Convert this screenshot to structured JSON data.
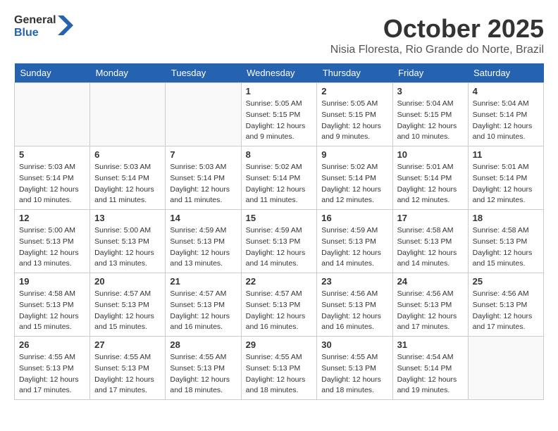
{
  "header": {
    "logo_general": "General",
    "logo_blue": "Blue",
    "month_title": "October 2025",
    "subtitle": "Nisia Floresta, Rio Grande do Norte, Brazil"
  },
  "weekdays": [
    "Sunday",
    "Monday",
    "Tuesday",
    "Wednesday",
    "Thursday",
    "Friday",
    "Saturday"
  ],
  "weeks": [
    [
      {
        "day": "",
        "info": ""
      },
      {
        "day": "",
        "info": ""
      },
      {
        "day": "",
        "info": ""
      },
      {
        "day": "1",
        "info": "Sunrise: 5:05 AM\nSunset: 5:15 PM\nDaylight: 12 hours\nand 9 minutes."
      },
      {
        "day": "2",
        "info": "Sunrise: 5:05 AM\nSunset: 5:15 PM\nDaylight: 12 hours\nand 9 minutes."
      },
      {
        "day": "3",
        "info": "Sunrise: 5:04 AM\nSunset: 5:15 PM\nDaylight: 12 hours\nand 10 minutes."
      },
      {
        "day": "4",
        "info": "Sunrise: 5:04 AM\nSunset: 5:14 PM\nDaylight: 12 hours\nand 10 minutes."
      }
    ],
    [
      {
        "day": "5",
        "info": "Sunrise: 5:03 AM\nSunset: 5:14 PM\nDaylight: 12 hours\nand 10 minutes."
      },
      {
        "day": "6",
        "info": "Sunrise: 5:03 AM\nSunset: 5:14 PM\nDaylight: 12 hours\nand 11 minutes."
      },
      {
        "day": "7",
        "info": "Sunrise: 5:03 AM\nSunset: 5:14 PM\nDaylight: 12 hours\nand 11 minutes."
      },
      {
        "day": "8",
        "info": "Sunrise: 5:02 AM\nSunset: 5:14 PM\nDaylight: 12 hours\nand 11 minutes."
      },
      {
        "day": "9",
        "info": "Sunrise: 5:02 AM\nSunset: 5:14 PM\nDaylight: 12 hours\nand 12 minutes."
      },
      {
        "day": "10",
        "info": "Sunrise: 5:01 AM\nSunset: 5:14 PM\nDaylight: 12 hours\nand 12 minutes."
      },
      {
        "day": "11",
        "info": "Sunrise: 5:01 AM\nSunset: 5:14 PM\nDaylight: 12 hours\nand 12 minutes."
      }
    ],
    [
      {
        "day": "12",
        "info": "Sunrise: 5:00 AM\nSunset: 5:13 PM\nDaylight: 12 hours\nand 13 minutes."
      },
      {
        "day": "13",
        "info": "Sunrise: 5:00 AM\nSunset: 5:13 PM\nDaylight: 12 hours\nand 13 minutes."
      },
      {
        "day": "14",
        "info": "Sunrise: 4:59 AM\nSunset: 5:13 PM\nDaylight: 12 hours\nand 13 minutes."
      },
      {
        "day": "15",
        "info": "Sunrise: 4:59 AM\nSunset: 5:13 PM\nDaylight: 12 hours\nand 14 minutes."
      },
      {
        "day": "16",
        "info": "Sunrise: 4:59 AM\nSunset: 5:13 PM\nDaylight: 12 hours\nand 14 minutes."
      },
      {
        "day": "17",
        "info": "Sunrise: 4:58 AM\nSunset: 5:13 PM\nDaylight: 12 hours\nand 14 minutes."
      },
      {
        "day": "18",
        "info": "Sunrise: 4:58 AM\nSunset: 5:13 PM\nDaylight: 12 hours\nand 15 minutes."
      }
    ],
    [
      {
        "day": "19",
        "info": "Sunrise: 4:58 AM\nSunset: 5:13 PM\nDaylight: 12 hours\nand 15 minutes."
      },
      {
        "day": "20",
        "info": "Sunrise: 4:57 AM\nSunset: 5:13 PM\nDaylight: 12 hours\nand 15 minutes."
      },
      {
        "day": "21",
        "info": "Sunrise: 4:57 AM\nSunset: 5:13 PM\nDaylight: 12 hours\nand 16 minutes."
      },
      {
        "day": "22",
        "info": "Sunrise: 4:57 AM\nSunset: 5:13 PM\nDaylight: 12 hours\nand 16 minutes."
      },
      {
        "day": "23",
        "info": "Sunrise: 4:56 AM\nSunset: 5:13 PM\nDaylight: 12 hours\nand 16 minutes."
      },
      {
        "day": "24",
        "info": "Sunrise: 4:56 AM\nSunset: 5:13 PM\nDaylight: 12 hours\nand 17 minutes."
      },
      {
        "day": "25",
        "info": "Sunrise: 4:56 AM\nSunset: 5:13 PM\nDaylight: 12 hours\nand 17 minutes."
      }
    ],
    [
      {
        "day": "26",
        "info": "Sunrise: 4:55 AM\nSunset: 5:13 PM\nDaylight: 12 hours\nand 17 minutes."
      },
      {
        "day": "27",
        "info": "Sunrise: 4:55 AM\nSunset: 5:13 PM\nDaylight: 12 hours\nand 17 minutes."
      },
      {
        "day": "28",
        "info": "Sunrise: 4:55 AM\nSunset: 5:13 PM\nDaylight: 12 hours\nand 18 minutes."
      },
      {
        "day": "29",
        "info": "Sunrise: 4:55 AM\nSunset: 5:13 PM\nDaylight: 12 hours\nand 18 minutes."
      },
      {
        "day": "30",
        "info": "Sunrise: 4:55 AM\nSunset: 5:13 PM\nDaylight: 12 hours\nand 18 minutes."
      },
      {
        "day": "31",
        "info": "Sunrise: 4:54 AM\nSunset: 5:14 PM\nDaylight: 12 hours\nand 19 minutes."
      },
      {
        "day": "",
        "info": ""
      }
    ]
  ]
}
